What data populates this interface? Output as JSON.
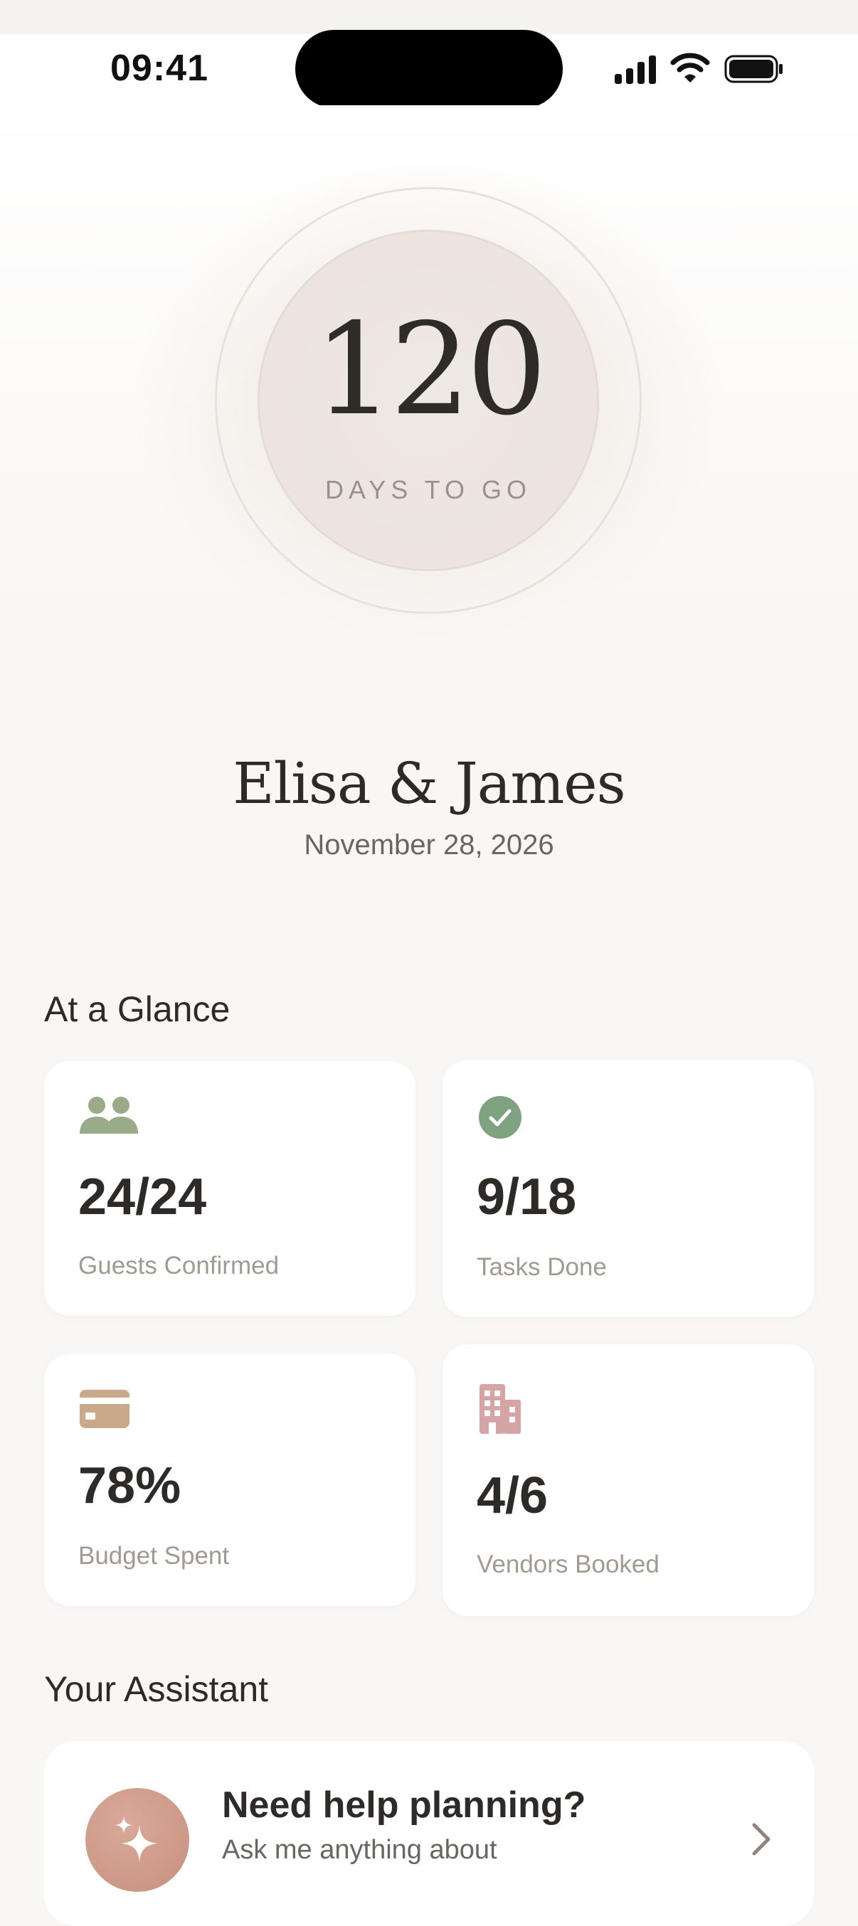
{
  "status_bar": {
    "time": "09:41"
  },
  "countdown": {
    "days": "120",
    "label": "DAYS TO GO"
  },
  "couple": {
    "names": "Elisa & James",
    "date": "November 28, 2026"
  },
  "glance": {
    "title": "At a Glance",
    "cards": [
      {
        "icon": "people-icon",
        "value": "24/24",
        "label": "Guests Confirmed",
        "accent": "#9aab8a"
      },
      {
        "icon": "check-circle-icon",
        "value": "9/18",
        "label": "Tasks Done",
        "accent": "#7fa380"
      },
      {
        "icon": "credit-card-icon",
        "value": "78%",
        "label": "Budget Spent",
        "accent": "#c9a98a"
      },
      {
        "icon": "building-icon",
        "value": "4/6",
        "label": "Vendors Booked",
        "accent": "#d6a4a4"
      }
    ]
  },
  "assistant": {
    "title": "Your Assistant",
    "card_title": "Need help planning?",
    "card_subtitle": "Ask me anything about",
    "icon": "sparkles-icon",
    "accent": "#cf9b8a"
  }
}
